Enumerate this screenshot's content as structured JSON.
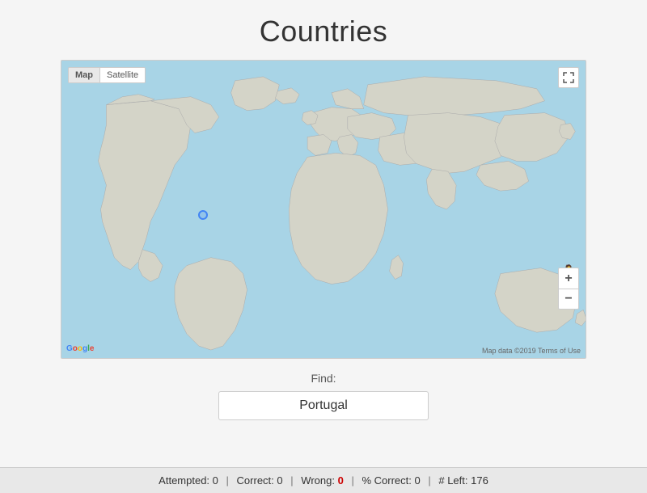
{
  "page": {
    "title": "Countries"
  },
  "map": {
    "type_map_label": "Map",
    "type_satellite_label": "Satellite",
    "fullscreen_icon": "⤢",
    "zoom_in_label": "+",
    "zoom_out_label": "−",
    "google_logo": "Google",
    "attribution": "Map data ©2019  Terms of Use"
  },
  "find": {
    "label": "Find:",
    "input_value": "Portugal",
    "input_placeholder": ""
  },
  "status": {
    "attempted_label": "Attempted:",
    "attempted_value": "0",
    "correct_label": "Correct:",
    "correct_value": "0",
    "wrong_label": "Wrong:",
    "wrong_value": "0",
    "pct_correct_label": "% Correct:",
    "pct_correct_value": "0",
    "left_label": "# Left:",
    "left_value": "176",
    "separator": "|"
  }
}
